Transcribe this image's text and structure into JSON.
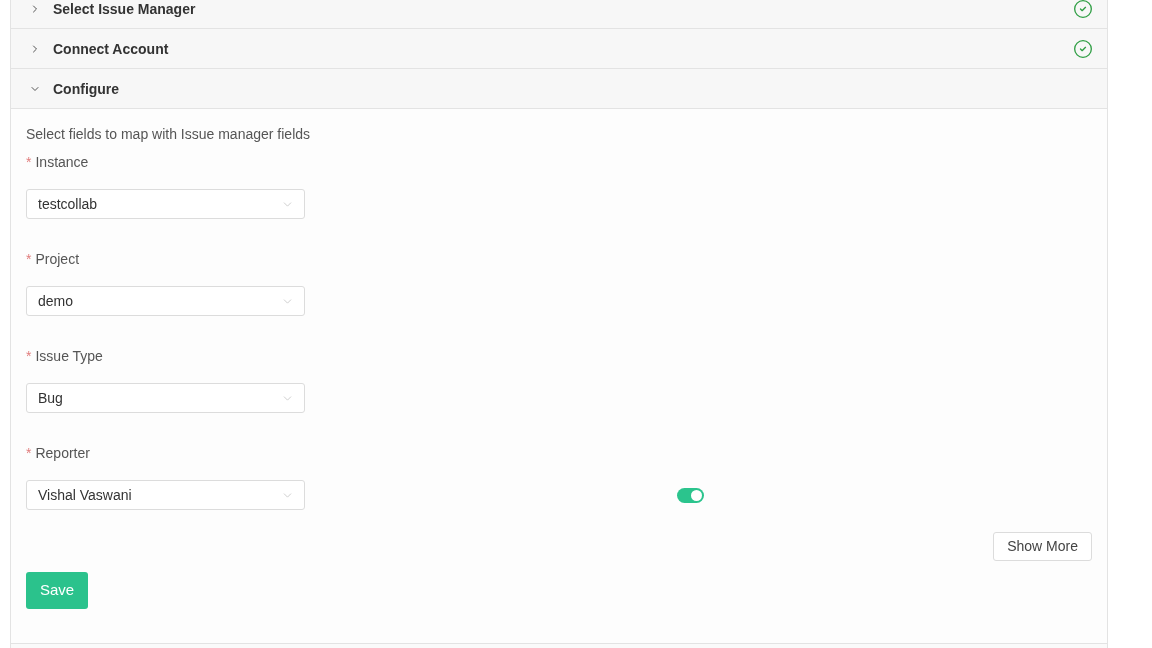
{
  "accordion": {
    "sections": [
      {
        "title": "Select Issue Manager",
        "expanded": false,
        "completed": true
      },
      {
        "title": "Connect Account",
        "expanded": false,
        "completed": true
      },
      {
        "title": "Configure",
        "expanded": true,
        "completed": false
      }
    ]
  },
  "configure": {
    "intro": "Select fields to map with Issue manager fields",
    "fields": [
      {
        "label": "Instance",
        "required_mark": "*",
        "value": "testcollab"
      },
      {
        "label": "Project",
        "required_mark": "*",
        "value": "demo"
      },
      {
        "label": "Issue Type",
        "required_mark": "*",
        "value": "Bug"
      },
      {
        "label": "Reporter",
        "required_mark": "*",
        "value": "Vishal Vaswani",
        "toggle": {
          "on": true
        }
      }
    ],
    "show_more_button": "Show More",
    "save_button": "Save"
  }
}
